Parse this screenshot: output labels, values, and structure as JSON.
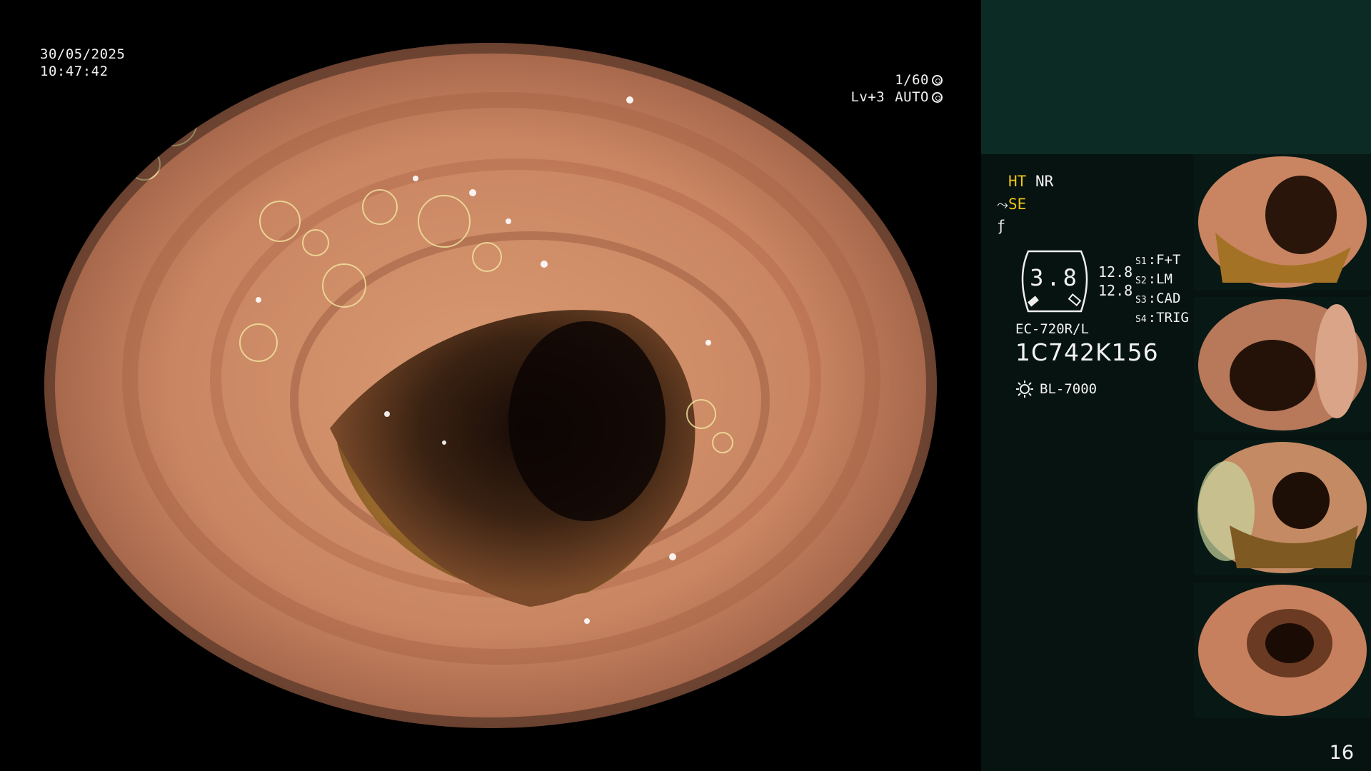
{
  "osd": {
    "date": "30/05/2025",
    "time": "10:47:42",
    "shutter": "1/60",
    "level": "Lv+3",
    "iris_mode": "AUTO"
  },
  "panel": {
    "mode_ht": "HT",
    "mode_nr": "NR",
    "mode_se": "SE",
    "mode_f": "ƒ",
    "star": "∗",
    "gauge_value": "3.8",
    "gauge_num_1": "12.8",
    "gauge_num_2": "12.8",
    "switches": [
      {
        "label": "S1",
        "value": "F+T"
      },
      {
        "label": "S2",
        "value": "LM"
      },
      {
        "label": "S3",
        "value": "CAD"
      },
      {
        "label": "S4",
        "value": "TRIG"
      }
    ],
    "scope_model": "EC-720R/L",
    "serial": "1C742K156",
    "light_source": "BL-7000"
  },
  "page_number": "16",
  "colors": {
    "panel_bg": "#061310",
    "panel_header": "#0d2b25",
    "accent_yellow": "#f0c419",
    "text": "#f2f2f2"
  }
}
